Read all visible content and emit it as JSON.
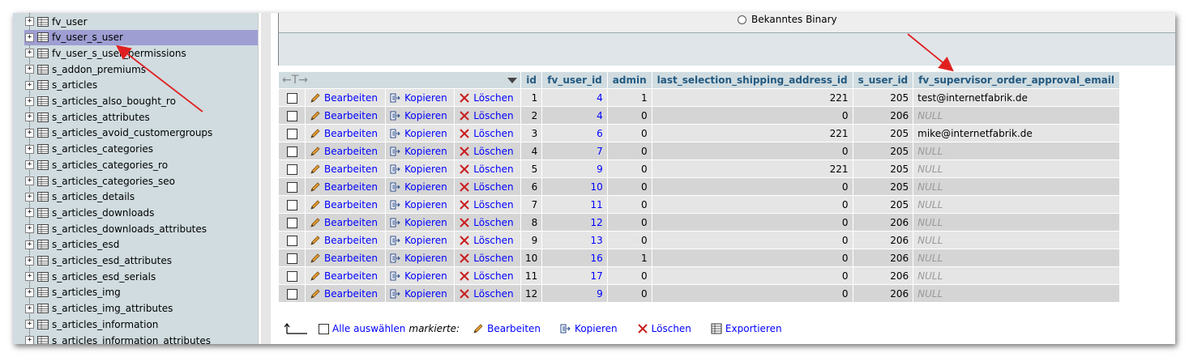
{
  "tree": {
    "items": [
      {
        "label": "fv_user",
        "selected": false
      },
      {
        "label": "fv_user_s_user",
        "selected": true
      },
      {
        "label": "fv_user_s_user_permissions",
        "selected": false
      },
      {
        "label": "s_addon_premiums",
        "selected": false
      },
      {
        "label": "s_articles",
        "selected": false
      },
      {
        "label": "s_articles_also_bought_ro",
        "selected": false
      },
      {
        "label": "s_articles_attributes",
        "selected": false
      },
      {
        "label": "s_articles_avoid_customergroups",
        "selected": false
      },
      {
        "label": "s_articles_categories",
        "selected": false
      },
      {
        "label": "s_articles_categories_ro",
        "selected": false
      },
      {
        "label": "s_articles_categories_seo",
        "selected": false
      },
      {
        "label": "s_articles_details",
        "selected": false
      },
      {
        "label": "s_articles_downloads",
        "selected": false
      },
      {
        "label": "s_articles_downloads_attributes",
        "selected": false
      },
      {
        "label": "s_articles_esd",
        "selected": false
      },
      {
        "label": "s_articles_esd_attributes",
        "selected": false
      },
      {
        "label": "s_articles_esd_serials",
        "selected": false
      },
      {
        "label": "s_articles_img",
        "selected": false
      },
      {
        "label": "s_articles_img_attributes",
        "selected": false
      },
      {
        "label": "s_articles_information",
        "selected": false
      },
      {
        "label": "s_articles_information_attributes",
        "selected": false
      }
    ]
  },
  "form": {
    "radio_label": "Bekanntes Binary"
  },
  "table": {
    "nav_arrows": "←T→",
    "columns": [
      "id",
      "fv_user_id",
      "admin",
      "last_selection_shipping_address_id",
      "s_user_id",
      "fv_supervisor_order_approval_email"
    ],
    "action_labels": {
      "edit": "Bearbeiten",
      "copy": "Kopieren",
      "delete": "Löschen"
    },
    "rows": [
      {
        "id": "1",
        "fv_user_id": "4",
        "admin": "1",
        "last": "221",
        "s_user_id": "205",
        "email": "test@internetfabrik.de"
      },
      {
        "id": "2",
        "fv_user_id": "4",
        "admin": "0",
        "last": "0",
        "s_user_id": "206",
        "email": "NULL"
      },
      {
        "id": "3",
        "fv_user_id": "6",
        "admin": "0",
        "last": "221",
        "s_user_id": "205",
        "email": "mike@internetfabrik.de"
      },
      {
        "id": "4",
        "fv_user_id": "7",
        "admin": "0",
        "last": "0",
        "s_user_id": "205",
        "email": "NULL"
      },
      {
        "id": "5",
        "fv_user_id": "9",
        "admin": "0",
        "last": "221",
        "s_user_id": "205",
        "email": "NULL"
      },
      {
        "id": "6",
        "fv_user_id": "10",
        "admin": "0",
        "last": "0",
        "s_user_id": "205",
        "email": "NULL"
      },
      {
        "id": "7",
        "fv_user_id": "11",
        "admin": "0",
        "last": "0",
        "s_user_id": "205",
        "email": "NULL"
      },
      {
        "id": "8",
        "fv_user_id": "12",
        "admin": "0",
        "last": "0",
        "s_user_id": "206",
        "email": "NULL"
      },
      {
        "id": "9",
        "fv_user_id": "13",
        "admin": "0",
        "last": "0",
        "s_user_id": "206",
        "email": "NULL"
      },
      {
        "id": "10",
        "fv_user_id": "16",
        "admin": "1",
        "last": "0",
        "s_user_id": "206",
        "email": "NULL"
      },
      {
        "id": "11",
        "fv_user_id": "17",
        "admin": "0",
        "last": "0",
        "s_user_id": "206",
        "email": "NULL"
      },
      {
        "id": "12",
        "fv_user_id": "9",
        "admin": "0",
        "last": "0",
        "s_user_id": "206",
        "email": "NULL"
      }
    ]
  },
  "bottom": {
    "select_all": "Alle auswählen",
    "marked": "markierte:",
    "edit": "Bearbeiten",
    "copy": "Kopieren",
    "delete": "Löschen",
    "export": "Exportieren"
  },
  "colors": {
    "header_bg": "#d0dce0",
    "header_text": "#235a81",
    "link": "#0000ff",
    "selected_row": "#9e9ed3",
    "annotation_arrow": "#e02020"
  }
}
